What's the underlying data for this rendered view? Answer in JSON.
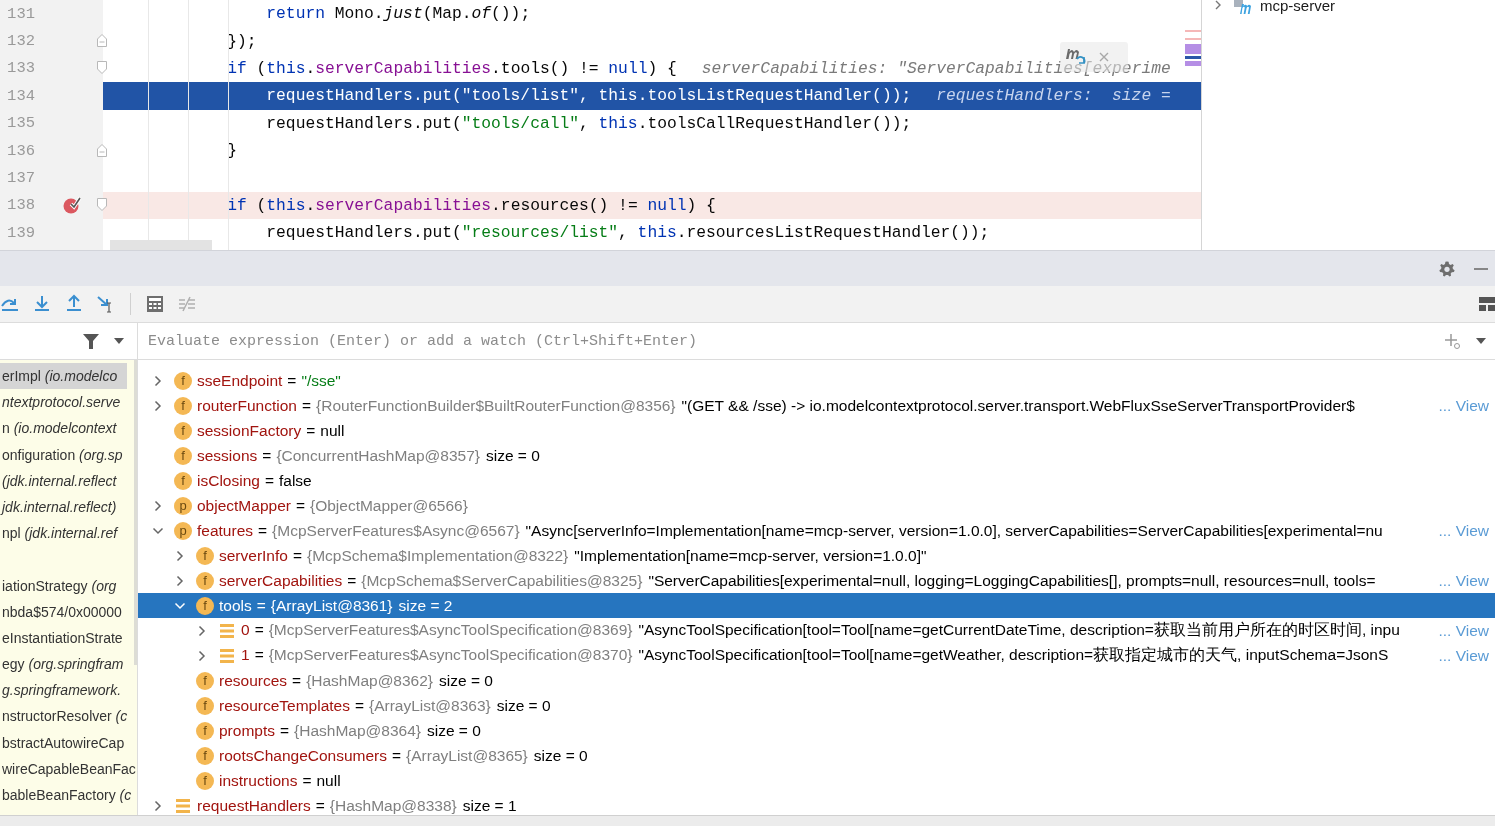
{
  "editor": {
    "lines": [
      {
        "number": "131",
        "kind": "plain",
        "current": false,
        "breakpoint": false,
        "tokens": [
          {
            "text": "                return",
            "kind": "keyword"
          },
          {
            "text": " Mono.",
            "kind": "plain"
          },
          {
            "text": "just",
            "kind": "static"
          },
          {
            "text": "(Map.",
            "kind": "plain"
          },
          {
            "text": "of",
            "kind": "static"
          },
          {
            "text": "());",
            "kind": "plain"
          }
        ]
      },
      {
        "number": "132",
        "kind": "fold-end",
        "current": false,
        "breakpoint": false,
        "tokens": [
          {
            "text": "            });",
            "kind": "plain"
          }
        ]
      },
      {
        "number": "133",
        "kind": "fold-start",
        "current": false,
        "breakpoint": false,
        "tokens": [
          {
            "text": "            if",
            "kind": "keyword"
          },
          {
            "text": " (",
            "kind": "plain"
          },
          {
            "text": "this",
            "kind": "keyword"
          },
          {
            "text": ".",
            "kind": "plain"
          },
          {
            "text": "serverCapabilities",
            "kind": "field"
          },
          {
            "text": ".tools() != ",
            "kind": "plain"
          },
          {
            "text": "null",
            "kind": "keyword"
          },
          {
            "text": ") {",
            "kind": "plain"
          }
        ],
        "hint": "serverCapabilities: \"ServerCapabilities[experime"
      },
      {
        "number": "134",
        "kind": "plain",
        "current": true,
        "breakpoint": false,
        "tokens": [
          {
            "text": "                requestHandlers.put(",
            "kind": "plain"
          },
          {
            "text": "\"tools/list\"",
            "kind": "string"
          },
          {
            "text": ", ",
            "kind": "plain"
          },
          {
            "text": "this",
            "kind": "keyword"
          },
          {
            "text": ".toolsListRequestHandler());",
            "kind": "plain"
          }
        ],
        "hint": "requestHandlers:  size ="
      },
      {
        "number": "135",
        "kind": "plain",
        "current": false,
        "breakpoint": false,
        "tokens": [
          {
            "text": "                requestHandlers.put(",
            "kind": "plain"
          },
          {
            "text": "\"tools/call\"",
            "kind": "string"
          },
          {
            "text": ", ",
            "kind": "plain"
          },
          {
            "text": "this",
            "kind": "keyword"
          },
          {
            "text": ".toolsCallRequestHandler());",
            "kind": "plain"
          }
        ]
      },
      {
        "number": "136",
        "kind": "fold-end",
        "current": false,
        "breakpoint": false,
        "tokens": [
          {
            "text": "            }",
            "kind": "plain"
          }
        ]
      },
      {
        "number": "137",
        "kind": "plain",
        "current": false,
        "breakpoint": false
      },
      {
        "number": "138",
        "kind": "fold-start",
        "current": false,
        "breakpoint": true,
        "tokens": [
          {
            "text": "            if",
            "kind": "keyword"
          },
          {
            "text": " (",
            "kind": "plain"
          },
          {
            "text": "this",
            "kind": "keyword"
          },
          {
            "text": ".",
            "kind": "plain"
          },
          {
            "text": "serverCapabilities",
            "kind": "field"
          },
          {
            "text": ".resources() != ",
            "kind": "plain"
          },
          {
            "text": "null",
            "kind": "keyword"
          },
          {
            "text": ") {",
            "kind": "plain"
          }
        ]
      },
      {
        "number": "139",
        "kind": "plain",
        "current": false,
        "breakpoint": false,
        "tokens": [
          {
            "text": "                requestHandlers.put(",
            "kind": "plain"
          },
          {
            "text": "\"resources/list\"",
            "kind": "string"
          },
          {
            "text": ", ",
            "kind": "plain"
          },
          {
            "text": "this",
            "kind": "keyword"
          },
          {
            "text": ".resourcesListRequestHandler());",
            "kind": "plain"
          }
        ]
      }
    ]
  },
  "project": {
    "items": [
      {
        "label": "mcp-server",
        "expanded": false
      }
    ]
  },
  "toolbar": [
    {
      "kind": "step-over",
      "disabled": false
    },
    {
      "kind": "step-into",
      "disabled": false
    },
    {
      "kind": "step-out",
      "disabled": false
    },
    {
      "kind": "run-to-cursor",
      "disabled": false
    },
    {
      "kind": "separator"
    },
    {
      "kind": "evaluate",
      "disabled": false
    },
    {
      "kind": "trace",
      "disabled": true
    }
  ],
  "watch": {
    "placeholder": "Evaluate expression (Enter) or add a watch (Ctrl+Shift+Enter)"
  },
  "frames": [
    {
      "kind": "frame",
      "text": "erImpl *(io.modelco*",
      "selected": true
    },
    {
      "kind": "frame",
      "text": "*ntextprotocol.serve*",
      "selected": false
    },
    {
      "kind": "frame",
      "text": "n *(io.modelcontext*",
      "selected": false
    },
    {
      "kind": "frame",
      "text": "onfiguration *(org.sp*",
      "selected": false
    },
    {
      "kind": "frame",
      "text": "*(jdk.internal.reflect*",
      "selected": false
    },
    {
      "kind": "frame",
      "text": "*jdk.internal.reflect)*",
      "selected": false
    },
    {
      "kind": "frame",
      "text": "npl *(jdk.internal.ref*",
      "selected": false
    },
    {
      "kind": "gap"
    },
    {
      "kind": "frame",
      "text": "iationStrategy *(org*",
      "selected": false
    },
    {
      "kind": "frame",
      "text": "nbda$574/0x00000",
      "selected": false
    },
    {
      "kind": "frame",
      "text": "eInstantiationStrate",
      "selected": false
    },
    {
      "kind": "frame",
      "text": "egy *(org.springfram*",
      "selected": false
    },
    {
      "kind": "frame",
      "text": "*g.springframework.*",
      "selected": false
    },
    {
      "kind": "frame",
      "text": "nstructorResolver *(c*",
      "selected": false
    },
    {
      "kind": "frame",
      "text": "bstractAutowireCap",
      "selected": false
    },
    {
      "kind": "frame",
      "text": "wireCapableBeanFac",
      "selected": false
    },
    {
      "kind": "frame",
      "text": "bableBeanFactory *(c*",
      "selected": false
    }
  ],
  "variables": [
    {
      "children": [
        {
          "kind": "field",
          "badge": "f",
          "name": "sseEndpoint",
          "sep": "=",
          "value": "\"/sse\"",
          "string_value": true,
          "expanded": false,
          "selected": false
        },
        {
          "kind": "field",
          "badge": "f",
          "name": "routerFunction",
          "sep": "=",
          "ref": "{RouterFunctionBuilder$BuiltRouterFunction@8356}",
          "value": "\"(GET && /sse) -> io.modelcontextprotocol.server.transport.WebFluxSseServerTransportProvider$",
          "link": "... View",
          "expanded": false,
          "selected": false
        },
        {
          "kind": "field",
          "badge": "f",
          "name": "sessionFactory",
          "sep": "=",
          "value": "null",
          "selected": false
        },
        {
          "kind": "field",
          "badge": "f",
          "name": "sessions",
          "sep": "=",
          "ref": "{ConcurrentHashMap@8357}",
          "value": "size = 0",
          "selected": false
        },
        {
          "kind": "field",
          "badge": "f",
          "name": "isClosing",
          "sep": "=",
          "value": "false",
          "selected": false
        }
      ]
    },
    {
      "kind": "property",
      "badge": "p",
      "name": "objectMapper",
      "sep": "=",
      "ref": "{ObjectMapper@6566}",
      "expanded": false,
      "selected": false
    },
    {
      "kind": "property",
      "badge": "p",
      "name": "features",
      "sep": "=",
      "ref": "{McpServerFeatures$Async@6567}",
      "value": "\"Async[serverInfo=Implementation[name=mcp-server, version=1.0.0], serverCapabilities=ServerCapabilities[experimental=nu",
      "link": "... View",
      "expanded": true,
      "selected": false,
      "children": [
        {
          "kind": "field",
          "badge": "f",
          "name": "serverInfo",
          "sep": "=",
          "ref": "{McpSchema$Implementation@8322}",
          "value": "\"Implementation[name=mcp-server, version=1.0.0]\"",
          "expanded": false,
          "selected": false
        },
        {
          "kind": "field",
          "badge": "f",
          "name": "serverCapabilities",
          "sep": "=",
          "ref": "{McpSchema$ServerCapabilities@8325}",
          "value": "\"ServerCapabilities[experimental=null, logging=LoggingCapabilities[], prompts=null, resources=null, tools=",
          "link": "... View",
          "expanded": false,
          "selected": false
        },
        {
          "kind": "field",
          "badge": "f",
          "name": "tools",
          "sep": "=",
          "ref": "{ArrayList@8361}",
          "value": "size = 2",
          "expanded": true,
          "selected": true,
          "children": [
            {
              "kind": "array",
              "name": "0",
              "sep": "=",
              "ref": "{McpServerFeatures$AsyncToolSpecification@8369}",
              "value": "\"AsyncToolSpecification[tool=Tool[name=getCurrentDateTime, description=获取当前用户所在的时区时间, inpu",
              "link": "... View",
              "expanded": false,
              "selected": false
            },
            {
              "kind": "array",
              "name": "1",
              "sep": "=",
              "ref": "{McpServerFeatures$AsyncToolSpecification@8370}",
              "value": "\"AsyncToolSpecification[tool=Tool[name=getWeather, description=获取指定城市的天气, inputSchema=JsonS",
              "link": "... View",
              "expanded": false,
              "selected": false
            }
          ]
        },
        {
          "kind": "field",
          "badge": "f",
          "name": "resources",
          "sep": "=",
          "ref": "{HashMap@8362}",
          "value": "size = 0",
          "selected": false
        },
        {
          "kind": "field",
          "badge": "f",
          "name": "resourceTemplates",
          "sep": "=",
          "ref": "{ArrayList@8363}",
          "value": "size = 0",
          "selected": false
        },
        {
          "kind": "field",
          "badge": "f",
          "name": "prompts",
          "sep": "=",
          "ref": "{HashMap@8364}",
          "value": "size = 0",
          "selected": false
        },
        {
          "kind": "field",
          "badge": "f",
          "name": "rootsChangeConsumers",
          "sep": "=",
          "ref": "{ArrayList@8365}",
          "value": "size = 0",
          "selected": false
        },
        {
          "kind": "field",
          "badge": "f",
          "name": "instructions",
          "sep": "=",
          "value": "null",
          "selected": false
        }
      ]
    },
    {
      "kind": "array",
      "name": "requestHandlers",
      "sep": "=",
      "ref": "{HashMap@8338}",
      "value": "size = 1",
      "expanded": false,
      "selected": false
    }
  ]
}
